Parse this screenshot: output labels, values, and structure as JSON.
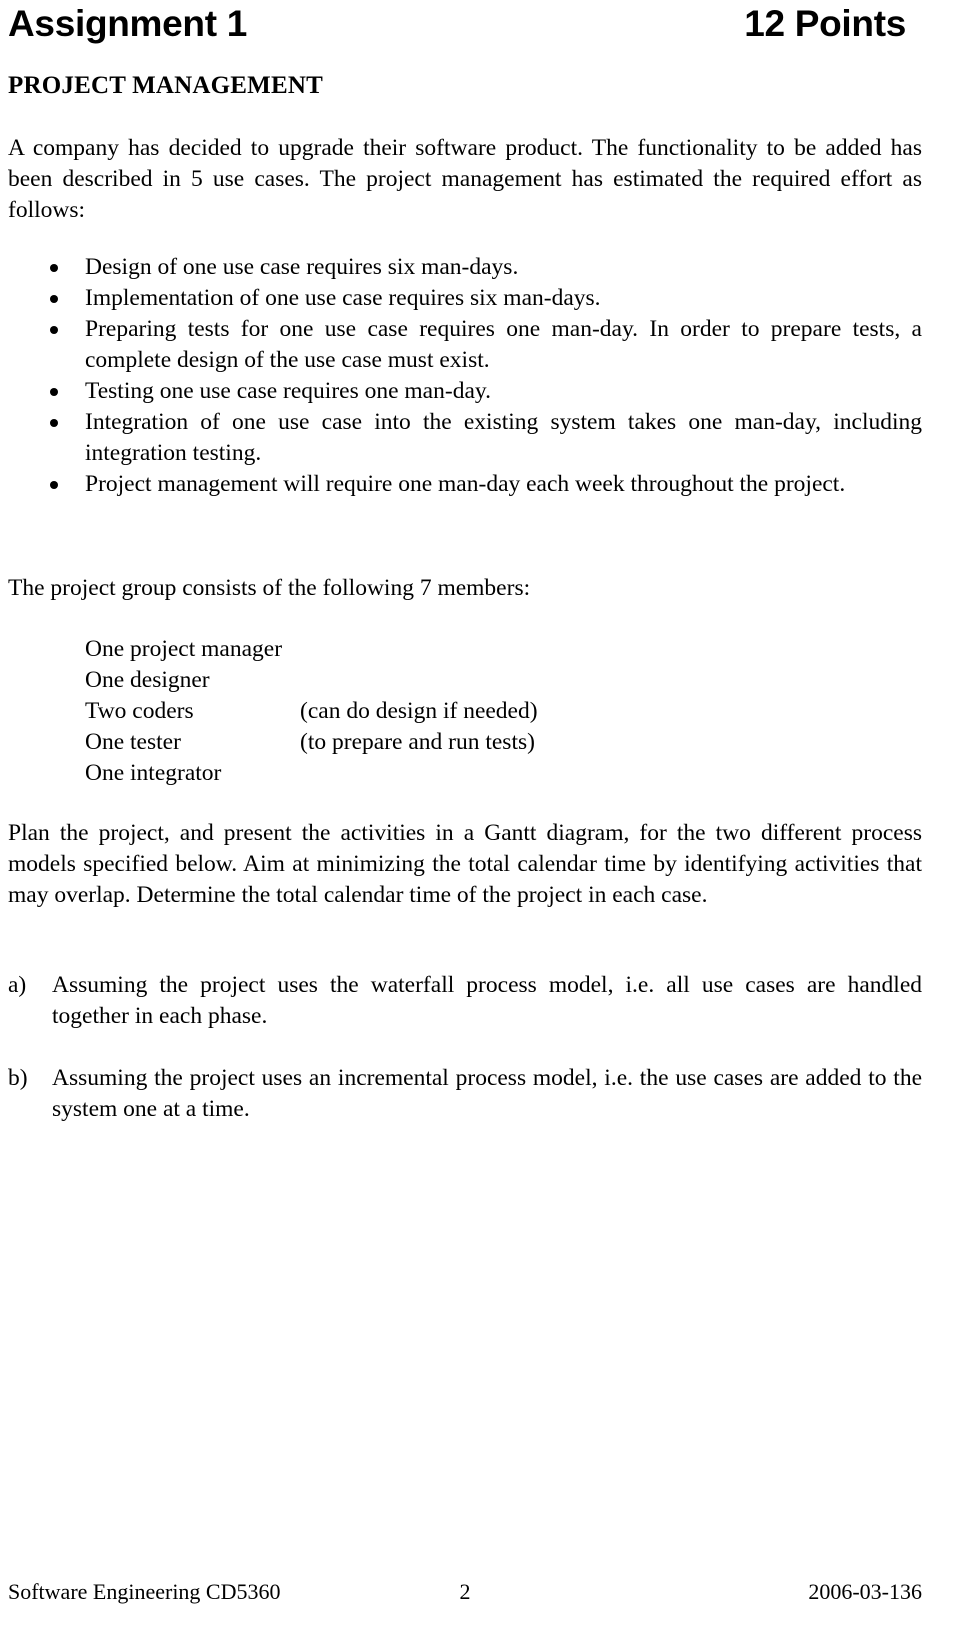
{
  "header": {
    "title": "Assignment 1",
    "points": "12 Points"
  },
  "section_heading": "PROJECT MANAGEMENT",
  "intro_paragraph": "A company has decided to upgrade their software product. The functionality to be added has been described in 5 use cases. The project management has estimated the required effort as follows:",
  "effort_bullets": [
    "Design of one use case requires six man-days.",
    "Implementation of one use case requires six man-days.",
    "Preparing tests for one use case requires one man-day. In order to prepare tests, a complete design of the use case must exist.",
    "Testing one use case requires one man-day.",
    "Integration of one use case into the existing system takes one man-day, including integration testing.",
    "Project management will require one man-day each week throughout the project."
  ],
  "group_intro": "The project group consists of the following  7 members:",
  "members": [
    {
      "role": "One project manager",
      "note": ""
    },
    {
      "role": "One designer",
      "note": ""
    },
    {
      "role": "Two coders",
      "note": "(can do design if needed)"
    },
    {
      "role": "One tester",
      "note": "(to prepare and run tests)"
    },
    {
      "role": "One integrator",
      "note": ""
    }
  ],
  "plan_paragraph": "Plan the project, and present the activities in a Gantt diagram, for the two different process models specified below. Aim at minimizing the total calendar time by identifying activities that may overlap.  Determine the total calendar time of the project in each case.",
  "items": [
    {
      "marker": "a)",
      "text": "Assuming the project uses the waterfall process model, i.e. all use cases are handled together in each phase."
    },
    {
      "marker": "b)",
      "text": "Assuming the project uses an incremental process model, i.e. the use cases are added to the system one at a time."
    }
  ],
  "footer": {
    "course": "Software Engineering CD5360",
    "page_number": "2",
    "date": "2006-03-136"
  }
}
